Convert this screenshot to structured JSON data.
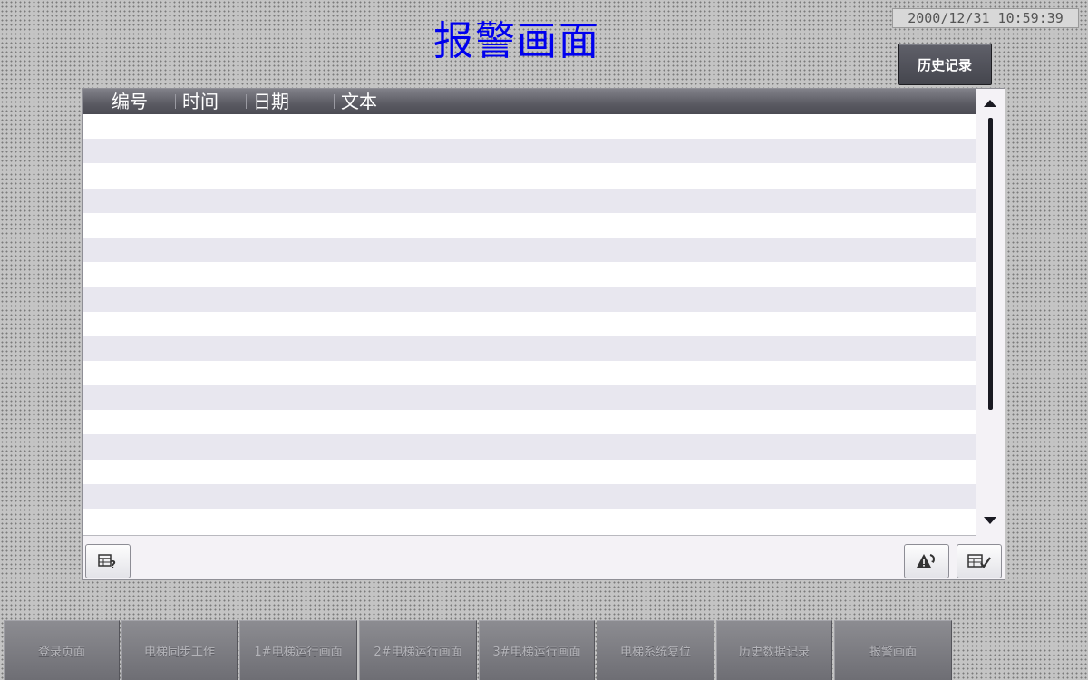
{
  "header": {
    "title": "报警画面",
    "clock": "2000/12/31 10:59:39",
    "history_button": "历史记录"
  },
  "alarm_table": {
    "columns": [
      "编号",
      "时间",
      "日期",
      "文本"
    ],
    "rows": []
  },
  "toolbar": {
    "help_icon": "table-help-icon",
    "ack_icon": "alarm-acknowledge-icon",
    "edit_icon": "table-edit-icon"
  },
  "nav": {
    "items": [
      "登录页面",
      "电梯同步工作",
      "1#电梯运行画面",
      "2#电梯运行画面",
      "3#电梯运行画面",
      "电梯系统复位",
      "历史数据记录",
      "报警画面"
    ]
  },
  "colors": {
    "title": "#0000ee",
    "header_bg": "#5a5a62",
    "row_alt": "#e8e7ef"
  }
}
